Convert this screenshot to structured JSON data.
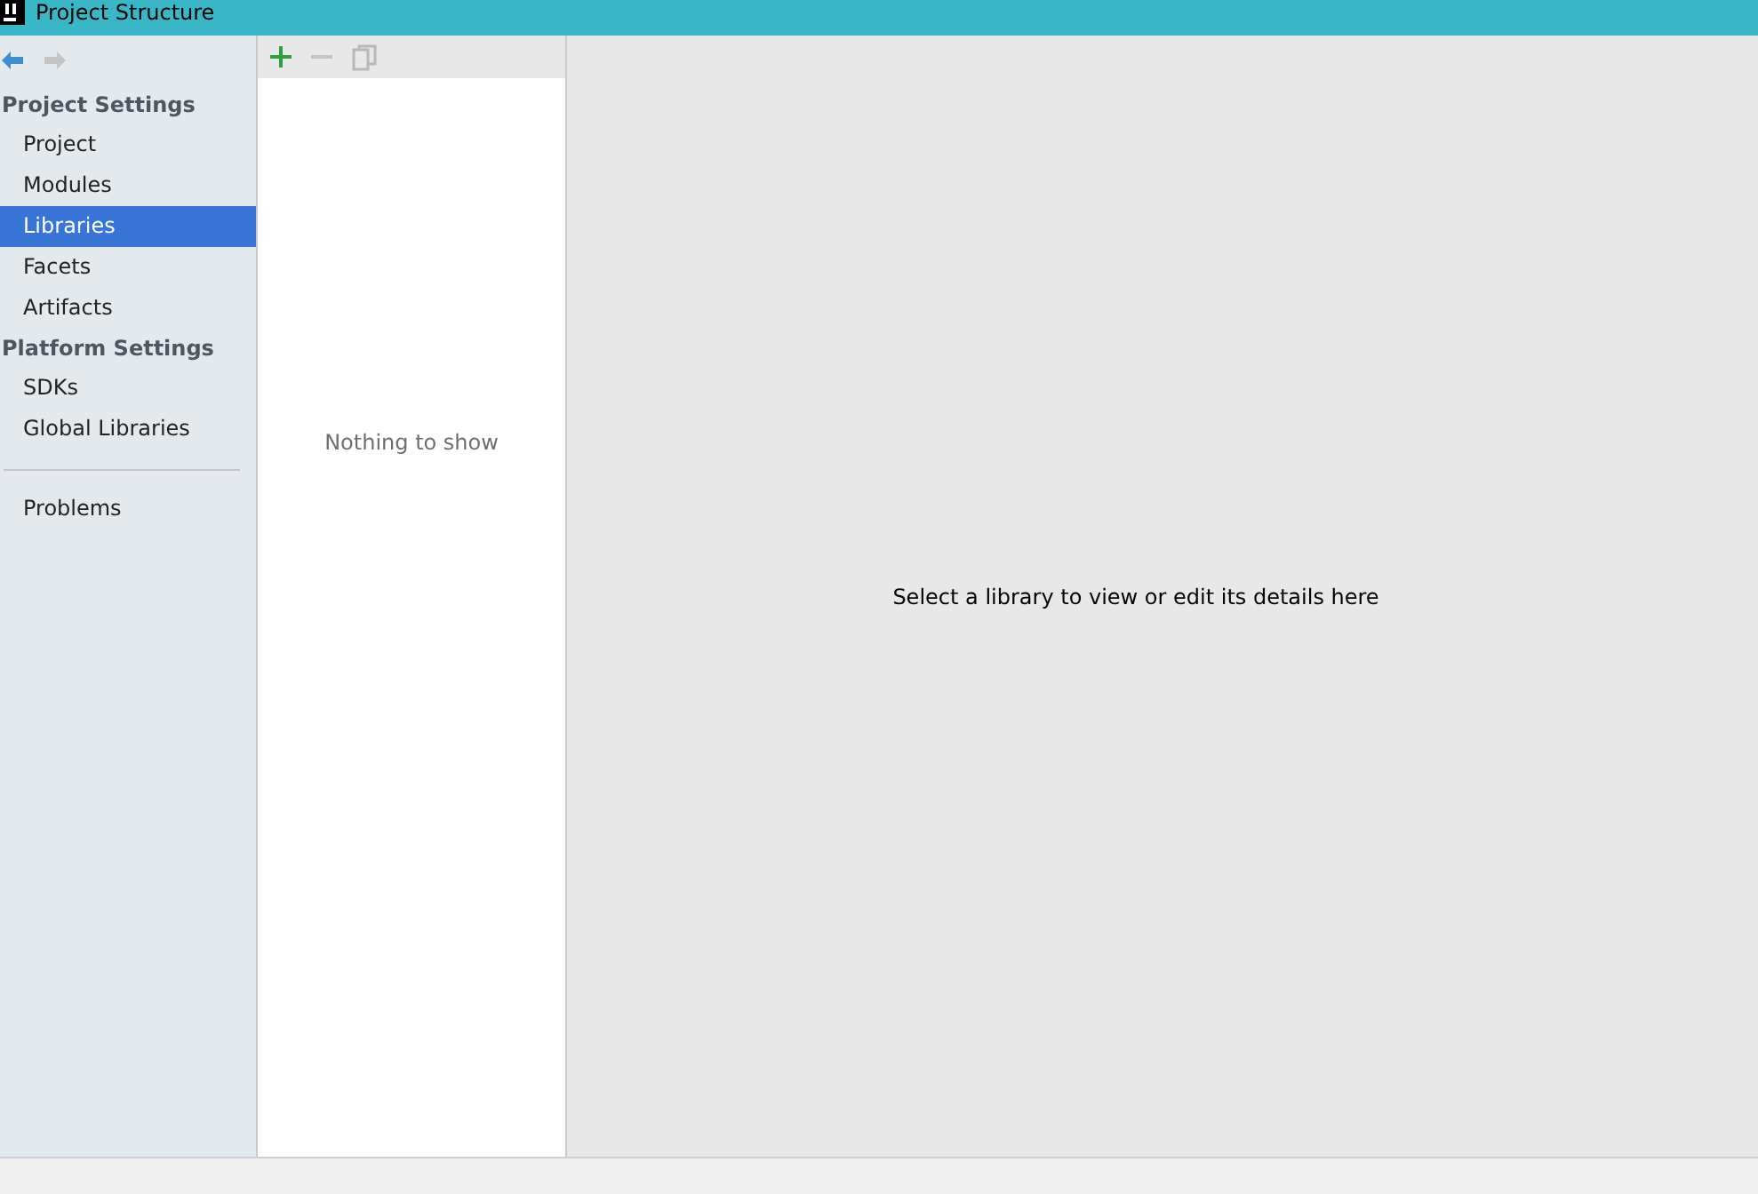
{
  "window": {
    "title": "Project Structure"
  },
  "nav": [
    {
      "kind": "back",
      "disabled": false
    },
    {
      "kind": "forward",
      "disabled": true
    }
  ],
  "sidebar": {
    "groups": [
      {
        "title": "Project Settings",
        "items": [
          {
            "label": "Project",
            "selected": false
          },
          {
            "label": "Modules",
            "selected": false
          },
          {
            "label": "Libraries",
            "selected": true
          },
          {
            "label": "Facets",
            "selected": false
          },
          {
            "label": "Artifacts",
            "selected": false
          }
        ]
      },
      {
        "title": "Platform Settings",
        "items": [
          {
            "label": "SDKs",
            "selected": false
          },
          {
            "label": "Global Libraries",
            "selected": false
          }
        ]
      }
    ],
    "bottom_items": [
      {
        "label": "Problems",
        "selected": false
      }
    ]
  },
  "list_toolbar": [
    {
      "kind": "add",
      "disabled": false
    },
    {
      "kind": "remove",
      "disabled": true
    },
    {
      "kind": "copy",
      "disabled": true
    }
  ],
  "list": {
    "empty_text": "Nothing to show"
  },
  "details": {
    "message": "Select a library to view or edit its details here"
  }
}
